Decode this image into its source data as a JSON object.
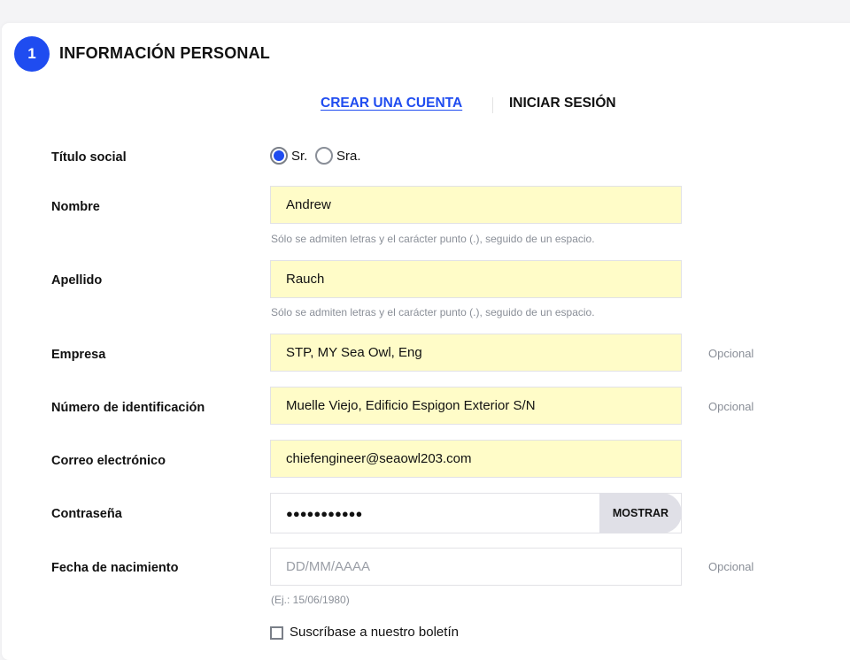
{
  "header": {
    "step": "1",
    "title": "INFORMACIÓN PERSONAL"
  },
  "tabs": {
    "create": "CREAR UNA CUENTA",
    "login": "INICIAR SESIÓN"
  },
  "form": {
    "social_title": {
      "label": "Título social",
      "options": [
        "Sr.",
        "Sra."
      ],
      "selected": "Sr."
    },
    "first_name": {
      "label": "Nombre",
      "value": "Andrew",
      "hint": "Sólo se admiten letras y el carácter punto (.), seguido de un espacio."
    },
    "last_name": {
      "label": "Apellido",
      "value": "Rauch",
      "hint": "Sólo se admiten letras y el carácter punto (.), seguido de un espacio."
    },
    "company": {
      "label": "Empresa",
      "value": "STP, MY Sea Owl, Eng",
      "optional": "Opcional"
    },
    "id_number": {
      "label": "Número de identificación",
      "value": "Muelle Viejo, Edificio Espigon Exterior S/N",
      "optional": "Opcional"
    },
    "email": {
      "label": "Correo electrónico",
      "value": "chiefengineer@seaowl203.com"
    },
    "password": {
      "label": "Contraseña",
      "value": "●●●●●●●●●●●",
      "show": "MOSTRAR"
    },
    "birthdate": {
      "label": "Fecha de nacimiento",
      "placeholder": "DD/MM/AAAA",
      "optional": "Opcional",
      "hint": "(Ej.: 15/06/1980)"
    },
    "newsletter": {
      "label": "Suscríbase a nuestro boletín",
      "checked": false
    }
  }
}
